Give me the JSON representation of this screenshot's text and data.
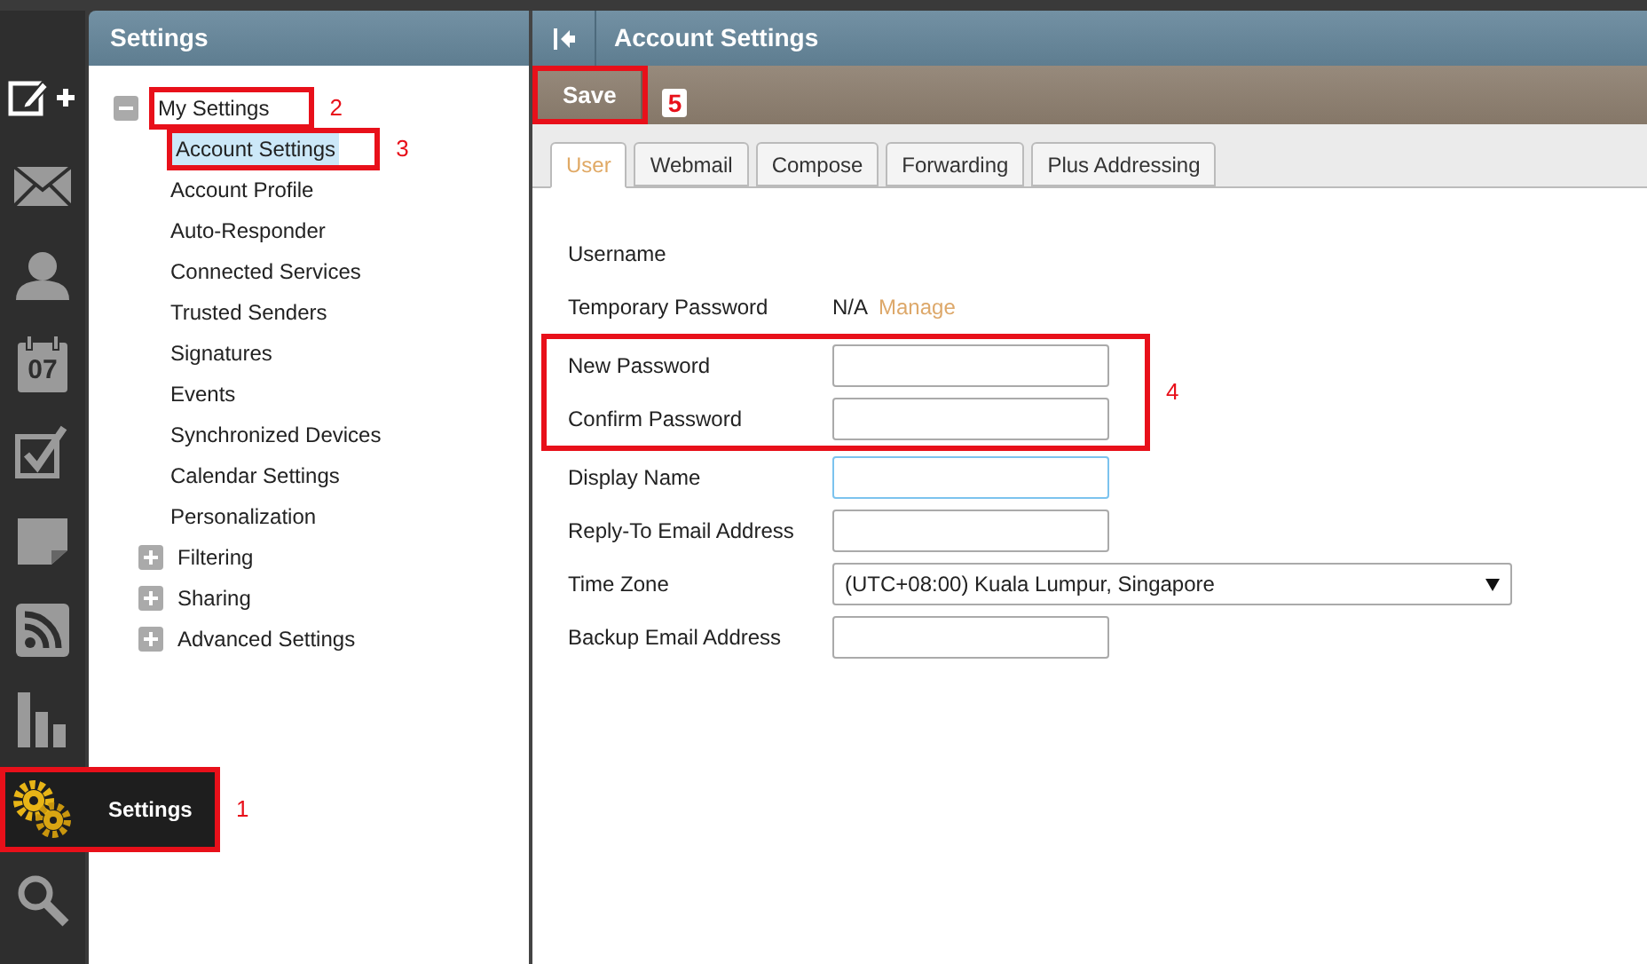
{
  "rail": {
    "items": [
      {
        "kind": "compose",
        "selected": false
      },
      {
        "kind": "mail",
        "selected": false
      },
      {
        "kind": "contacts",
        "selected": false
      },
      {
        "kind": "calendar",
        "badge": "07",
        "selected": false
      },
      {
        "kind": "tasks",
        "selected": false
      },
      {
        "kind": "notes",
        "selected": false
      },
      {
        "kind": "rss",
        "selected": false
      },
      {
        "kind": "reports",
        "selected": false
      },
      {
        "kind": "settings",
        "label": "Settings",
        "selected": true,
        "annotation": "1"
      },
      {
        "kind": "search",
        "selected": false
      }
    ]
  },
  "settings_panel": {
    "title": "Settings",
    "tree": [
      {
        "label": "My Settings",
        "expanded": true,
        "selected": false,
        "annotation": "2",
        "children": [
          {
            "label": "Account Settings",
            "selected": true,
            "annotation": "3"
          },
          {
            "label": "Account Profile",
            "selected": false
          },
          {
            "label": "Auto-Responder",
            "selected": false
          },
          {
            "label": "Connected Services",
            "selected": false
          },
          {
            "label": "Trusted Senders",
            "selected": false
          },
          {
            "label": "Signatures",
            "selected": false
          },
          {
            "label": "Events",
            "selected": false
          },
          {
            "label": "Synchronized Devices",
            "selected": false
          },
          {
            "label": "Calendar Settings",
            "selected": false
          },
          {
            "label": "Personalization",
            "selected": false
          }
        ]
      },
      {
        "label": "Filtering",
        "expanded": false,
        "selected": false
      },
      {
        "label": "Sharing",
        "expanded": false,
        "selected": false
      },
      {
        "label": "Advanced Settings",
        "expanded": false,
        "selected": false
      }
    ]
  },
  "main": {
    "title": "Account Settings",
    "toolbar": {
      "buttons": [
        {
          "label": "Save",
          "annotation": "5"
        }
      ]
    },
    "tabs": [
      {
        "label": "User",
        "selected": true
      },
      {
        "label": "Webmail",
        "selected": false
      },
      {
        "label": "Compose",
        "selected": false
      },
      {
        "label": "Forwarding",
        "selected": false
      },
      {
        "label": "Plus Addressing",
        "selected": false
      }
    ],
    "form": {
      "rows": [
        {
          "kind": "static",
          "label": "Username"
        },
        {
          "kind": "text",
          "label": "Temporary Password",
          "value": "N/A",
          "link": "Manage"
        },
        {
          "kind": "group",
          "annotation": "4",
          "rows": [
            {
              "kind": "input",
              "label": "New Password",
              "focused": false
            },
            {
              "kind": "input",
              "label": "Confirm Password",
              "focused": false
            }
          ]
        },
        {
          "kind": "input",
          "label": "Display Name",
          "focused": true
        },
        {
          "kind": "input",
          "label": "Reply-To Email Address",
          "focused": false
        },
        {
          "kind": "select",
          "label": "Time Zone",
          "value": "(UTC+08:00) Kuala Lumpur, Singapore"
        },
        {
          "kind": "input",
          "label": "Backup Email Address",
          "focused": false
        }
      ]
    }
  }
}
